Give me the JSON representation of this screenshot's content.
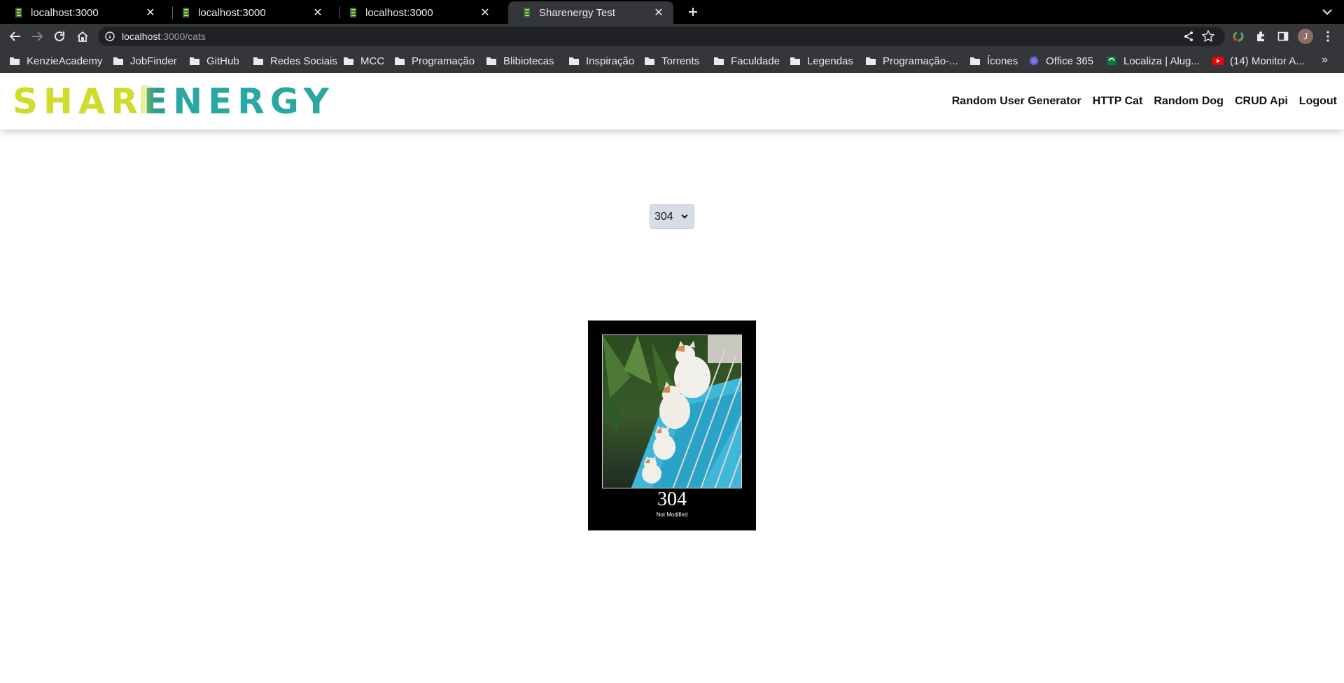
{
  "browser": {
    "tabs": [
      {
        "title": "localhost:3000",
        "active": false
      },
      {
        "title": "localhost:3000",
        "active": false
      },
      {
        "title": "localhost:3000",
        "active": false
      },
      {
        "title": "Sharenergy Test",
        "active": true
      }
    ],
    "new_tab_icon": "plus-icon",
    "tab_search_icon": "chevron-down-icon",
    "address": {
      "host": "localhost",
      "path": ":3000/cats"
    },
    "profile_initial": "J",
    "bookmarks": [
      {
        "label": "KenzieAcademy",
        "icon": "folder-icon"
      },
      {
        "label": "JobFinder",
        "icon": "folder-icon"
      },
      {
        "label": "GitHub",
        "icon": "folder-icon"
      },
      {
        "label": "Redes Sociais",
        "icon": "folder-icon"
      },
      {
        "label": "MCC",
        "icon": "folder-icon"
      },
      {
        "label": "Programação",
        "icon": "folder-icon"
      },
      {
        "label": "Blibiotecas",
        "icon": "folder-icon"
      },
      {
        "label": "Inspiração",
        "icon": "folder-icon"
      },
      {
        "label": "Torrents",
        "icon": "folder-icon"
      },
      {
        "label": "Faculdade",
        "icon": "folder-icon"
      },
      {
        "label": "Legendas",
        "icon": "folder-icon"
      },
      {
        "label": "Programação-...",
        "icon": "folder-icon"
      },
      {
        "label": "Ícones",
        "icon": "folder-icon"
      },
      {
        "label": "Office 365",
        "icon": "office-icon"
      },
      {
        "label": "Localiza | Alug...",
        "icon": "localiza-icon"
      },
      {
        "label": "(14) Monitor A...",
        "icon": "youtube-icon"
      }
    ],
    "bookmarks_more": "»"
  },
  "app": {
    "logo": {
      "part1": "SHAR",
      "part2": "E",
      "part3": "NERGY"
    },
    "nav": [
      "Random User Generator",
      "HTTP Cat",
      "Random Dog",
      "CRUD Api",
      "Logout"
    ],
    "status_select": {
      "value": "304"
    },
    "cat_image": {
      "code": "304",
      "message": "Not Modified"
    }
  },
  "colors": {
    "logo_yellow": "#cfdc2b",
    "logo_teal": "#2aa7a3",
    "chrome_dark": "#35363a"
  }
}
